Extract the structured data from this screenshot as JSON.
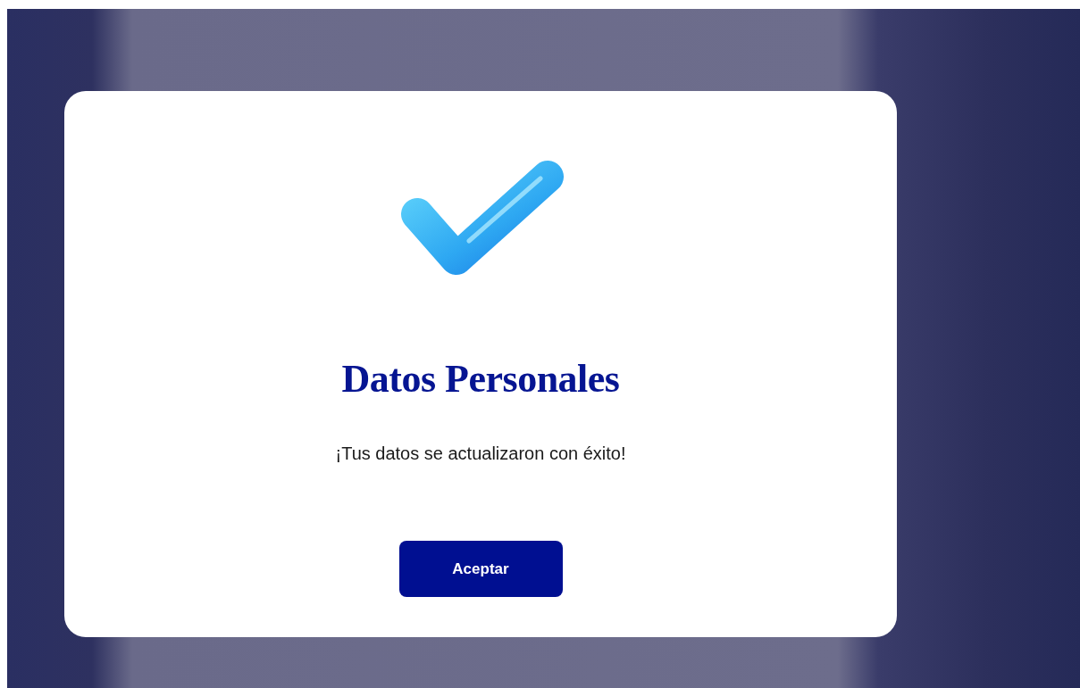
{
  "dialog": {
    "title": "Datos Personales",
    "message": "¡Tus datos se actualizaron con éxito!",
    "button": "Aceptar"
  }
}
